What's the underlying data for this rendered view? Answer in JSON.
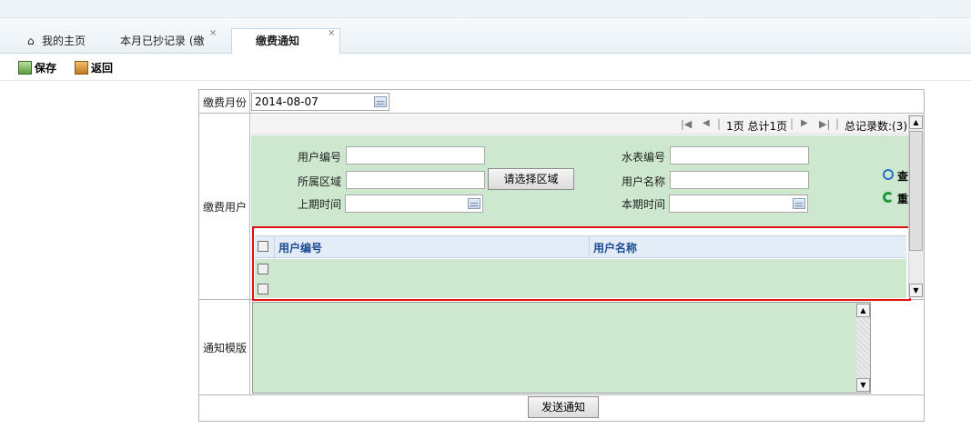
{
  "tabs": [
    {
      "label": "我的主页",
      "icon": "home-icon"
    },
    {
      "label": "本月已抄记录 (缴",
      "close": "×"
    },
    {
      "label": "缴费通知",
      "close": "×",
      "active": true
    }
  ],
  "toolbar": {
    "save_label": "保存",
    "back_label": "返回"
  },
  "form": {
    "month_label": "缴费月份",
    "month_value": "2014-08-07",
    "users_label": "缴费用户",
    "template_label": "通知模版",
    "send_label": "发送通知"
  },
  "pager": {
    "page_info": "1页 总计1页",
    "total": "总记录数:(3)",
    "sep": "|"
  },
  "search": {
    "user_no_label": "用户编号",
    "meter_no_label": "水表编号",
    "area_label": "所属区域",
    "area_button": "请选择区域",
    "user_name_label": "用户名称",
    "prev_time_label": "上期时间",
    "curr_time_label": "本期时间",
    "query_label": "查",
    "reset_label": "重"
  },
  "grid": {
    "columns": [
      "用户编号",
      "用户名称"
    ],
    "row_count": 2
  },
  "colors": {
    "accent_border": "#e01010",
    "panel_green": "#cde8cf",
    "header_text": "#1b4c94"
  }
}
